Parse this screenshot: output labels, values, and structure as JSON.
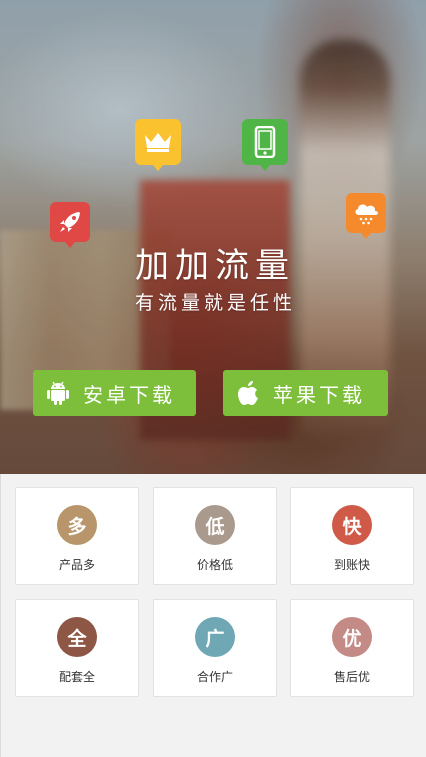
{
  "hero": {
    "title": "加加流量",
    "slogan": "有流量就是任性",
    "icons": [
      "crown-icon",
      "smartphone-icon",
      "rocket-icon",
      "cloud-rain-icon"
    ],
    "colors": {
      "crown": "#f9c22e",
      "phone": "#4fb547",
      "rocket": "#e04846",
      "weather": "#f58a2c",
      "button": "#7dbf3b"
    }
  },
  "download": {
    "android_label": "安卓下载",
    "ios_label": "苹果下载"
  },
  "features": [
    {
      "glyph": "多",
      "caption": "产品多",
      "color": "#b9956b"
    },
    {
      "glyph": "低",
      "caption": "价格低",
      "color": "#a99a8d"
    },
    {
      "glyph": "快",
      "caption": "到账快",
      "color": "#cf5a48"
    },
    {
      "glyph": "全",
      "caption": "配套全",
      "color": "#8e5745"
    },
    {
      "glyph": "广",
      "caption": "合作广",
      "color": "#6fa7b5"
    },
    {
      "glyph": "优",
      "caption": "售后优",
      "color": "#c48a86"
    }
  ]
}
